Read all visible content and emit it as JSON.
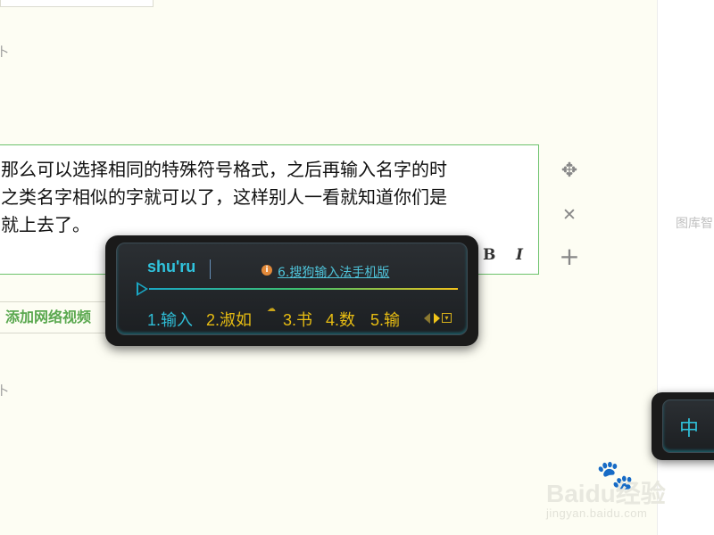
{
  "page": {
    "side_link_1": "卜",
    "side_link_2": "卜"
  },
  "editor": {
    "lines": [
      "那么可以选择相同的特殊符号格式，之后再输入名字的时",
      "之类名字相似的字就可以了，这样别人一看就知道你们是",
      "就上去了。"
    ],
    "toolbar": {
      "bold": "B",
      "italic": "I"
    }
  },
  "controls": {
    "move": "✥",
    "close": "✕",
    "add": "+"
  },
  "sidebar": {
    "label": "图库智"
  },
  "add_video": {
    "label": "添加网络视频"
  },
  "ime": {
    "pinyin": "shu'ru",
    "tip_icon": "i",
    "tip_text": "6.搜狗输入法手机版",
    "candidates": [
      "1.输入",
      "2.淑如",
      "3.书",
      "4.数",
      "5.输"
    ],
    "status_mode": "中",
    "colors": {
      "accent": "#2fbfd8",
      "candidate": "#e8bd12"
    }
  },
  "watermark": {
    "text": "Baidu经验",
    "url": "jingyan.baidu.com"
  }
}
